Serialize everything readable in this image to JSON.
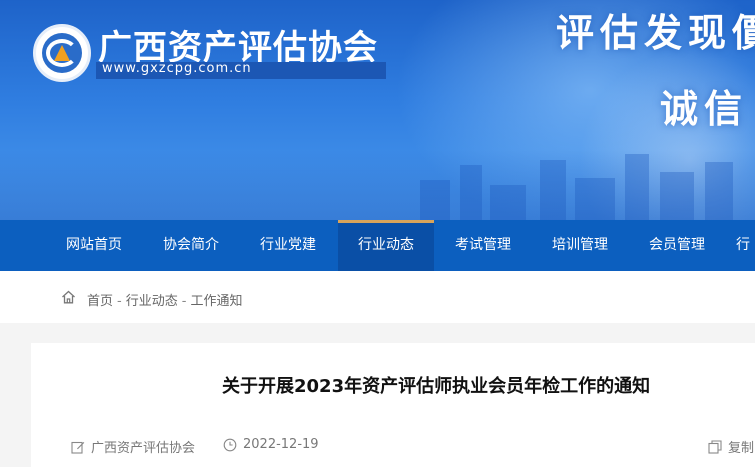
{
  "header": {
    "org_name": "广西资产评估协会",
    "org_url": "www.gxzcpg.com.cn",
    "slogan_line1": "评估发现價",
    "slogan_line2": "诚信"
  },
  "nav": {
    "items": [
      {
        "label": "网站首页"
      },
      {
        "label": "协会简介"
      },
      {
        "label": "行业党建"
      },
      {
        "label": "行业动态",
        "active": true
      },
      {
        "label": "考试管理"
      },
      {
        "label": "培训管理"
      },
      {
        "label": "会员管理"
      },
      {
        "label": "行"
      }
    ]
  },
  "breadcrumb": {
    "items": [
      "首页",
      "行业动态",
      "工作通知"
    ],
    "separator": "-"
  },
  "article": {
    "title": "关于开展2023年资产评估师执业会员年检工作的通知",
    "author": "广西资产评估协会",
    "date": "2022-12-19",
    "copy_label": "复制"
  },
  "icons": {
    "home": "home-icon",
    "author": "edit-icon",
    "date": "clock-icon",
    "copy": "copy-icon"
  },
  "colors": {
    "nav_bg": "#0c5fbf",
    "nav_active_bg": "#0a4fa6",
    "nav_active_accent": "#d9a45a",
    "banner_top": "#1e63c9",
    "banner_bottom": "#4b9aee"
  }
}
